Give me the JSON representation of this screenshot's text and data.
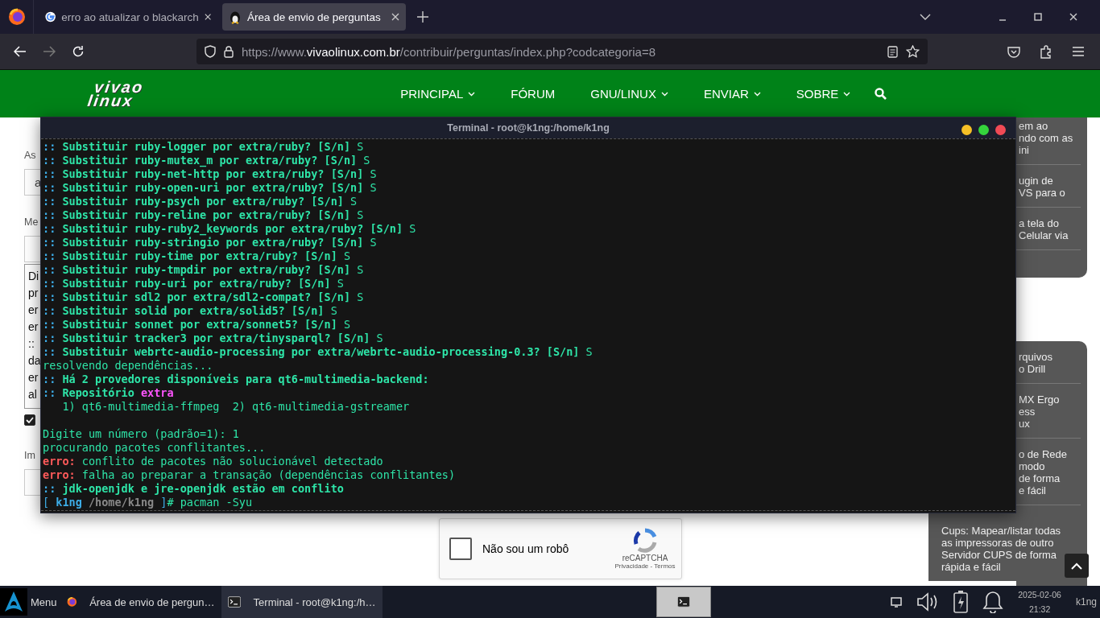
{
  "browser": {
    "tabs": [
      {
        "title": "erro ao atualizar o blackarch",
        "selected": false
      },
      {
        "title": "Área de envio de perguntas",
        "selected": true
      }
    ],
    "url_parts": [
      {
        "text": "https://www.",
        "kind": "dim"
      },
      {
        "text": "vivaolinux.com.br",
        "kind": "host"
      },
      {
        "text": "/contribuir/perguntas/index.php?codcategoria=8",
        "kind": "dim"
      }
    ]
  },
  "site": {
    "logo": [
      "vivao",
      "linux"
    ],
    "nav": [
      {
        "label": "PRINCIPAL",
        "dropdown": true
      },
      {
        "label": "FÓRUM",
        "dropdown": false
      },
      {
        "label": "GNU/LINUX",
        "dropdown": true
      },
      {
        "label": "ENVIAR",
        "dropdown": true
      },
      {
        "label": "SOBRE",
        "dropdown": true
      }
    ]
  },
  "form": {
    "subject_label": "As",
    "subject_value": "a",
    "message_label": "Me",
    "message_lines": [
      "Di",
      "pr",
      "er",
      "er",
      "::",
      "da",
      "er",
      "al"
    ],
    "assistant": {
      "checked": true
    },
    "image_label": "Im",
    "captcha": {
      "label": "Não sou um robô",
      "brand": "reCAPTCHA",
      "links": "Privacidade - Termos",
      "checked": false
    }
  },
  "sidebar": {
    "top_items": [
      [
        "em ao",
        "ndo com as",
        "ini"
      ],
      [
        "ugin de",
        "VS para o"
      ],
      [
        "a tela do",
        "Celular via"
      ]
    ],
    "tips": [
      {
        "kind": "clipped",
        "lines": [
          "rquivos",
          "o Drill"
        ]
      },
      {
        "kind": "clipped",
        "lines": [
          "MX Ergo",
          "ess",
          "ux"
        ]
      },
      {
        "kind": "clipped",
        "lines": [
          "o de Rede",
          "modo",
          "de forma",
          "e fácil"
        ]
      },
      {
        "kind": "full",
        "lines": [
          "Cups: Mapear/listar todas",
          "as impressoras de outro",
          "Servidor CUPS de forma",
          "rápida e fácil"
        ]
      }
    ]
  },
  "terminal": {
    "title": "Terminal - root@k1ng:/home/k1ng",
    "lines": [
      {
        "kind": "plain",
        "parts": [
          {
            "t": ":: ",
            "kind": "prefix"
          },
          {
            "t": "Substituir ruby-logger por extra/ruby? [S/n]",
            "kind": "bold"
          },
          {
            "t": " S",
            "kind": "normal"
          }
        ]
      },
      {
        "kind": "plain",
        "parts": [
          {
            "t": ":: ",
            "kind": "prefix"
          },
          {
            "t": "Substituir ruby-mutex_m por extra/ruby? [S/n]",
            "kind": "bold"
          },
          {
            "t": " S",
            "kind": "normal"
          }
        ]
      },
      {
        "kind": "plain",
        "parts": [
          {
            "t": ":: ",
            "kind": "prefix"
          },
          {
            "t": "Substituir ruby-net-http por extra/ruby? [S/n]",
            "kind": "bold"
          },
          {
            "t": " S",
            "kind": "normal"
          }
        ]
      },
      {
        "kind": "plain",
        "parts": [
          {
            "t": ":: ",
            "kind": "prefix"
          },
          {
            "t": "Substituir ruby-open-uri por extra/ruby? [S/n]",
            "kind": "bold"
          },
          {
            "t": " S",
            "kind": "normal"
          }
        ]
      },
      {
        "kind": "plain",
        "parts": [
          {
            "t": ":: ",
            "kind": "prefix"
          },
          {
            "t": "Substituir ruby-psych por extra/ruby? [S/n]",
            "kind": "bold"
          },
          {
            "t": " S",
            "kind": "normal"
          }
        ]
      },
      {
        "kind": "plain",
        "parts": [
          {
            "t": ":: ",
            "kind": "prefix"
          },
          {
            "t": "Substituir ruby-reline por extra/ruby? [S/n]",
            "kind": "bold"
          },
          {
            "t": " S",
            "kind": "normal"
          }
        ]
      },
      {
        "kind": "plain",
        "parts": [
          {
            "t": ":: ",
            "kind": "prefix"
          },
          {
            "t": "Substituir ruby-ruby2_keywords por extra/ruby? [S/n]",
            "kind": "bold"
          },
          {
            "t": " S",
            "kind": "normal"
          }
        ]
      },
      {
        "kind": "plain",
        "parts": [
          {
            "t": ":: ",
            "kind": "prefix"
          },
          {
            "t": "Substituir ruby-stringio por extra/ruby? [S/n]",
            "kind": "bold"
          },
          {
            "t": " S",
            "kind": "normal"
          }
        ]
      },
      {
        "kind": "plain",
        "parts": [
          {
            "t": ":: ",
            "kind": "prefix"
          },
          {
            "t": "Substituir ruby-time por extra/ruby? [S/n]",
            "kind": "bold"
          },
          {
            "t": " S",
            "kind": "normal"
          }
        ]
      },
      {
        "kind": "plain",
        "parts": [
          {
            "t": ":: ",
            "kind": "prefix"
          },
          {
            "t": "Substituir ruby-tmpdir por extra/ruby? [S/n]",
            "kind": "bold"
          },
          {
            "t": " S",
            "kind": "normal"
          }
        ]
      },
      {
        "kind": "plain",
        "parts": [
          {
            "t": ":: ",
            "kind": "prefix"
          },
          {
            "t": "Substituir ruby-uri por extra/ruby? [S/n]",
            "kind": "bold"
          },
          {
            "t": " S",
            "kind": "normal"
          }
        ]
      },
      {
        "kind": "plain",
        "parts": [
          {
            "t": ":: ",
            "kind": "prefix"
          },
          {
            "t": "Substituir sdl2 por extra/sdl2-compat? [S/n]",
            "kind": "bold"
          },
          {
            "t": " S",
            "kind": "normal"
          }
        ]
      },
      {
        "kind": "plain",
        "parts": [
          {
            "t": ":: ",
            "kind": "prefix"
          },
          {
            "t": "Substituir solid por extra/solid5? [S/n]",
            "kind": "bold"
          },
          {
            "t": " S",
            "kind": "normal"
          }
        ]
      },
      {
        "kind": "plain",
        "parts": [
          {
            "t": ":: ",
            "kind": "prefix"
          },
          {
            "t": "Substituir sonnet por extra/sonnet5? [S/n]",
            "kind": "bold"
          },
          {
            "t": " S",
            "kind": "normal"
          }
        ]
      },
      {
        "kind": "plain",
        "parts": [
          {
            "t": ":: ",
            "kind": "prefix"
          },
          {
            "t": "Substituir tracker3 por extra/tinysparql? [S/n]",
            "kind": "bold"
          },
          {
            "t": " S",
            "kind": "normal"
          }
        ]
      },
      {
        "kind": "plain",
        "parts": [
          {
            "t": ":: ",
            "kind": "prefix"
          },
          {
            "t": "Substituir webrtc-audio-processing por extra/webrtc-audio-processing-0.3? [S/n]",
            "kind": "bold"
          },
          {
            "t": " S",
            "kind": "normal"
          }
        ]
      },
      {
        "kind": "plain",
        "parts": [
          {
            "t": "resolvendo dependências...",
            "kind": "normal"
          }
        ]
      },
      {
        "kind": "plain",
        "parts": [
          {
            "t": ":: ",
            "kind": "prefix"
          },
          {
            "t": "Há 2 provedores disponíveis para qt6-multimedia-backend:",
            "kind": "bold"
          }
        ]
      },
      {
        "kind": "plain",
        "parts": [
          {
            "t": ":: ",
            "kind": "prefix"
          },
          {
            "t": "Repositório ",
            "kind": "bold"
          },
          {
            "t": "extra",
            "kind": "magenta"
          }
        ]
      },
      {
        "kind": "plain",
        "parts": [
          {
            "t": "   1) qt6-multimedia-ffmpeg  2) qt6-multimedia-gstreamer",
            "kind": "normal"
          }
        ]
      },
      {
        "kind": "spaced",
        "parts": [
          {
            "t": "Digite um número (padrão=1): 1",
            "kind": "normal"
          }
        ]
      },
      {
        "kind": "plain",
        "parts": [
          {
            "t": "procurando pacotes conflitantes...",
            "kind": "normal"
          }
        ]
      },
      {
        "kind": "plain",
        "parts": [
          {
            "t": "erro:",
            "kind": "error"
          },
          {
            "t": " conflito de pacotes não solucionável detectado",
            "kind": "normal"
          }
        ]
      },
      {
        "kind": "plain",
        "parts": [
          {
            "t": "erro:",
            "kind": "error"
          },
          {
            "t": " falha ao preparar a transação (dependências conflitantes)",
            "kind": "normal"
          }
        ]
      },
      {
        "kind": "plain",
        "parts": [
          {
            "t": ":: ",
            "kind": "prefix"
          },
          {
            "t": "jdk-openjdk e jre-openjdk estão em conflito",
            "kind": "bold"
          }
        ]
      },
      {
        "kind": "plain",
        "parts": [
          {
            "t": "[ ",
            "kind": "bracket"
          },
          {
            "t": "k1ng",
            "kind": "user"
          },
          {
            "t": " /home/k1ng ",
            "kind": "path"
          },
          {
            "t": "]",
            "kind": "bracket"
          },
          {
            "t": "# pacman -Syu",
            "kind": "normal"
          }
        ]
      }
    ]
  },
  "taskbar": {
    "menu": "Menu",
    "tasks": [
      {
        "title": "Área de envio de pergun…",
        "selected": false
      },
      {
        "title": "Terminal - root@k1ng:/h…",
        "selected": true
      }
    ],
    "date": "2025-02-06",
    "time": "21:32",
    "user": "k1ng"
  }
}
